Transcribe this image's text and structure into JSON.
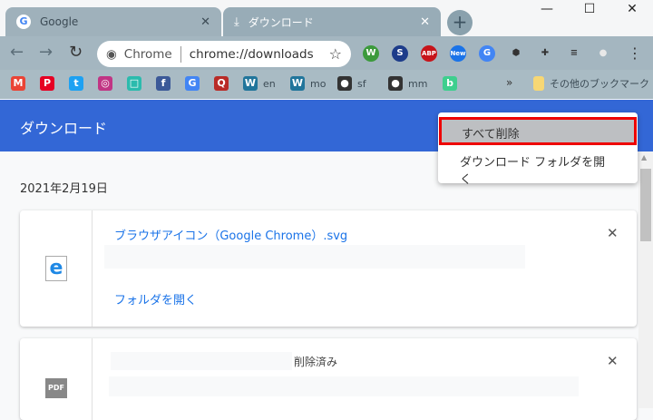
{
  "tabs": [
    {
      "title": "Google",
      "icon": "google-icon",
      "close": "✕"
    },
    {
      "title": "ダウンロード",
      "icon": "download-icon",
      "close": "✕"
    }
  ],
  "window": {
    "minimize": "—",
    "maximize": "☐",
    "close": "✕"
  },
  "toolbar": {
    "back": "←",
    "forward": "→",
    "reload": "↻",
    "omnibox_site": "Chrome",
    "omnibox_url": "chrome://downloads",
    "star": "☆",
    "menu": "⋮",
    "extensions": [
      {
        "label": "W",
        "color": "#3c9a3c"
      },
      {
        "label": "S",
        "color": "#1d3c8a"
      },
      {
        "label": "ABP",
        "color": "#c7141a"
      },
      {
        "label": "New",
        "color": "#1a73e8"
      },
      {
        "label": "G",
        "color": "#4285f4"
      },
      {
        "label": "⬢",
        "color": "#333"
      },
      {
        "label": "✚",
        "color": "#333"
      },
      {
        "label": "≡",
        "color": "#333"
      },
      {
        "label": "●",
        "color": "#e8e8e8"
      }
    ]
  },
  "bookmarks": [
    {
      "icon": "M",
      "label": "",
      "color": "#ea4335"
    },
    {
      "icon": "P",
      "label": "",
      "color": "#e60023"
    },
    {
      "icon": "t",
      "label": "",
      "color": "#1da1f2"
    },
    {
      "icon": "◎",
      "label": "",
      "color": "#c13584"
    },
    {
      "icon": "□",
      "label": "",
      "color": "#2bbbad"
    },
    {
      "icon": "f",
      "label": "",
      "color": "#3b5998"
    },
    {
      "icon": "G",
      "label": "",
      "color": "#4285f4"
    },
    {
      "icon": "Q",
      "label": "",
      "color": "#b92b27"
    },
    {
      "icon": "W",
      "label": "en",
      "color": "#21759b"
    },
    {
      "icon": "W",
      "label": "mo",
      "color": "#21759b"
    },
    {
      "icon": "●",
      "label": "sf",
      "color": "#333"
    },
    {
      "icon": "●",
      "label": "mm",
      "color": "#333"
    },
    {
      "icon": "b",
      "label": "",
      "color": "#3ecf8e"
    }
  ],
  "bookmarks_more": "»",
  "other_bookmarks": "その他のブックマーク",
  "page": {
    "title": "ダウンロード",
    "date": "2021年2月19日"
  },
  "downloads": [
    {
      "filename": "ブラウザアイコン（Google Chrome）.svg",
      "action": "フォルダを開く",
      "close": "✕"
    },
    {
      "status": "削除済み",
      "icon_label": "PDF",
      "close": "✕"
    }
  ],
  "menu": {
    "items": [
      "すべて削除",
      "ダウンロード フォルダを開く"
    ]
  }
}
